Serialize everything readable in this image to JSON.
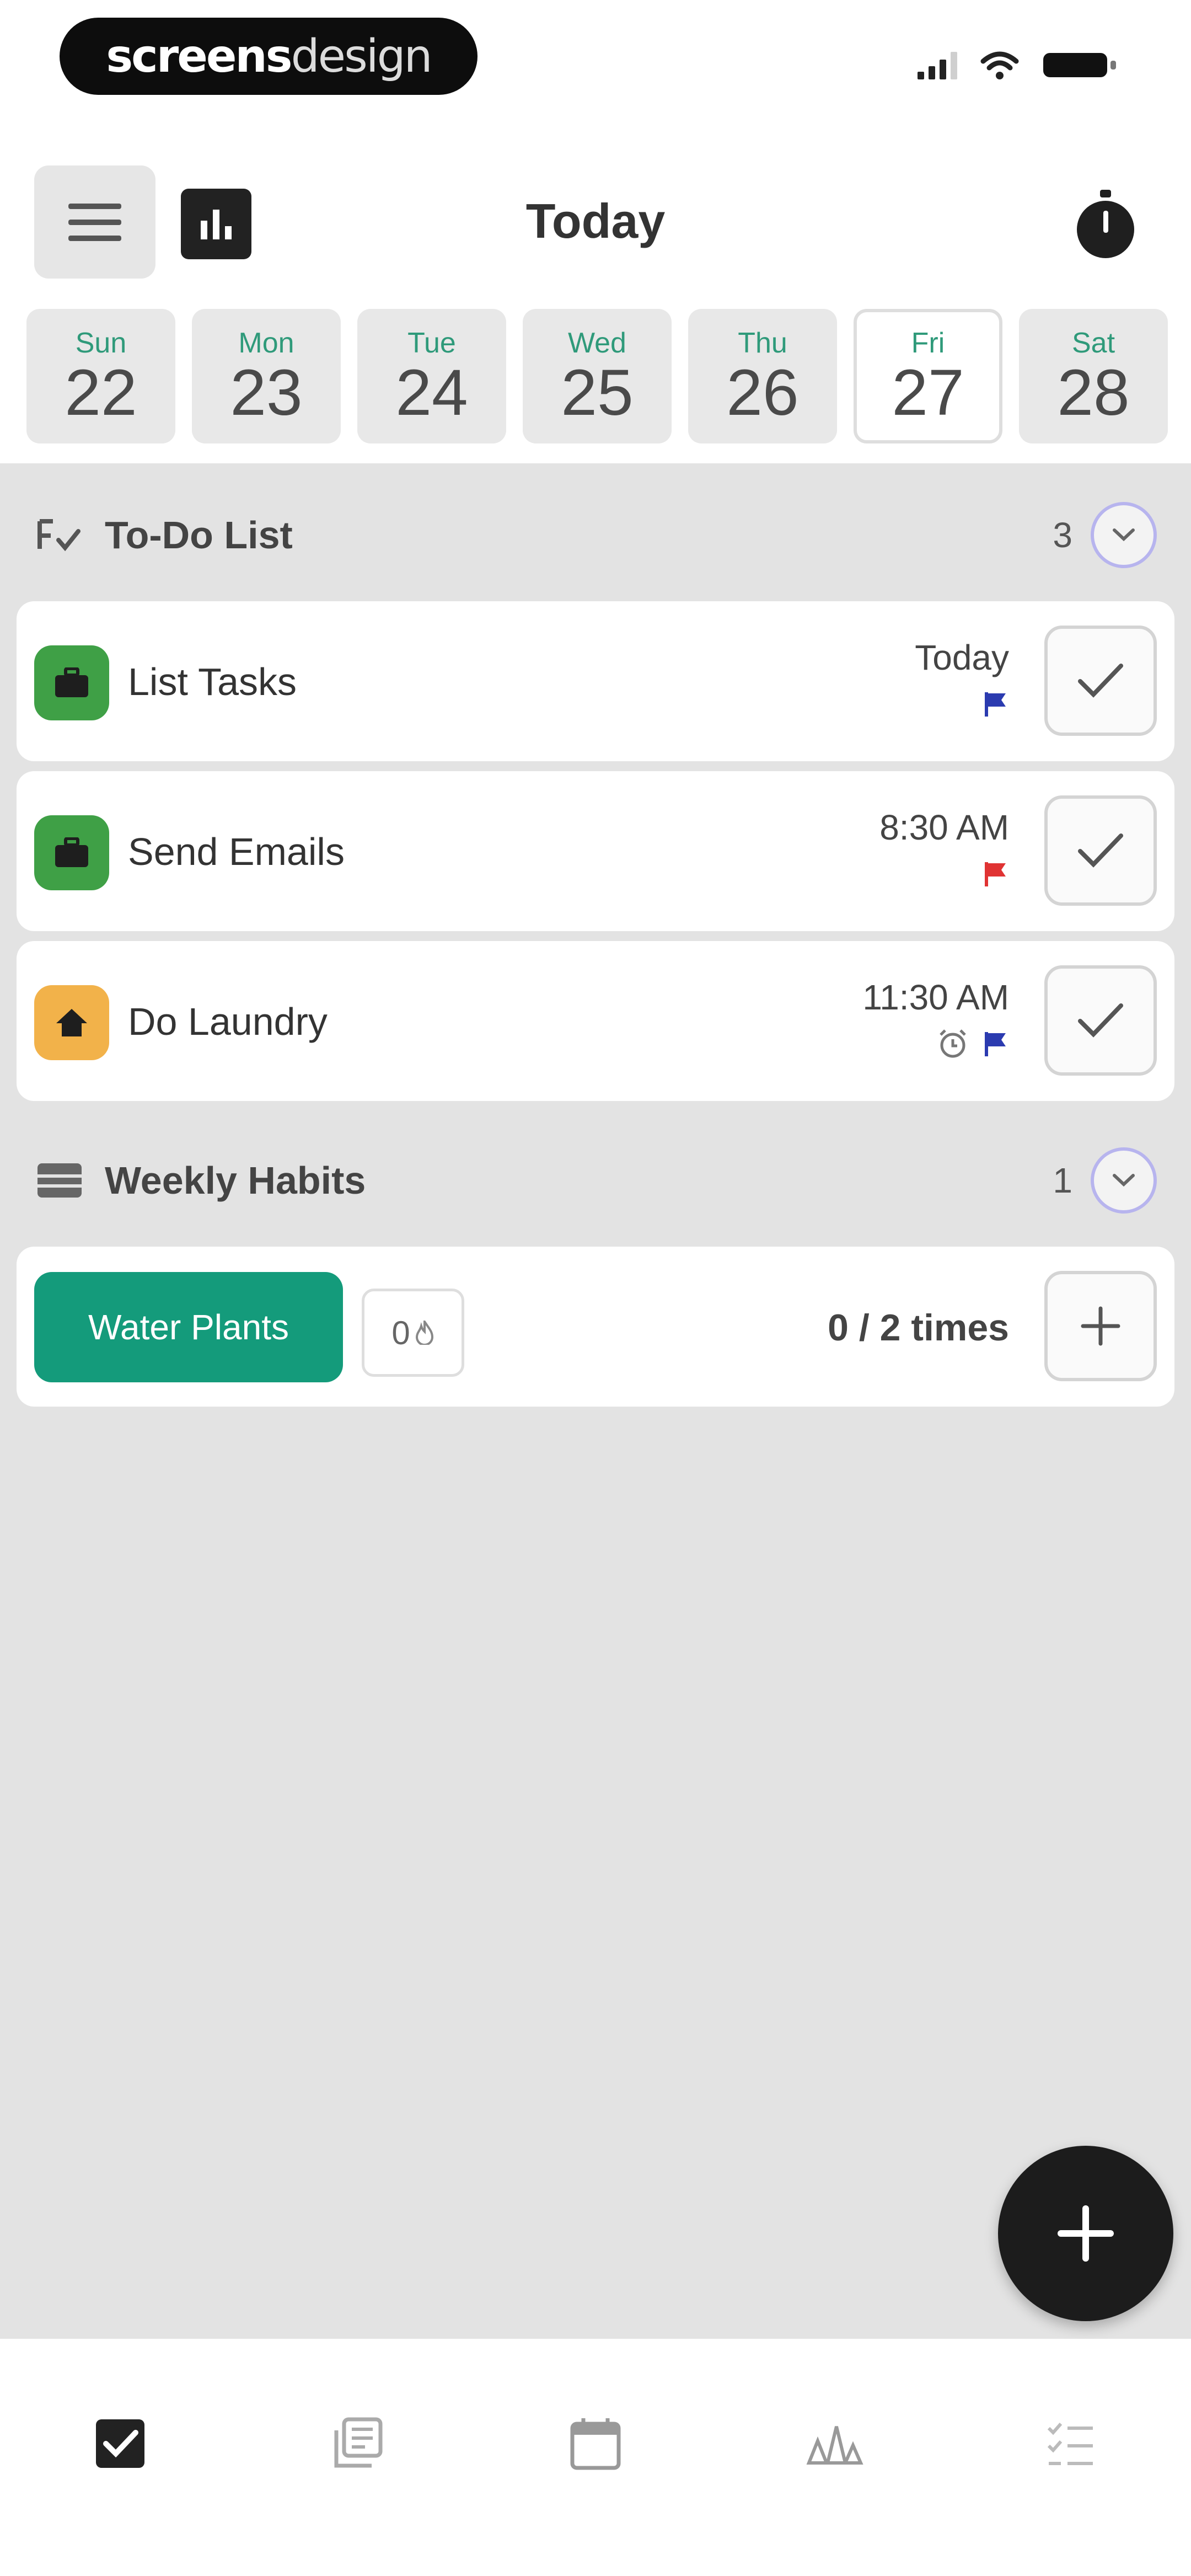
{
  "status_bar": {
    "brand_bold": "screens",
    "brand_light": "design"
  },
  "header": {
    "title": "Today",
    "icons": [
      "menu-icon",
      "stats-icon",
      "stopwatch-icon"
    ]
  },
  "week": [
    {
      "day": "Sun",
      "date": "22",
      "selected": false
    },
    {
      "day": "Mon",
      "date": "23",
      "selected": false
    },
    {
      "day": "Tue",
      "date": "24",
      "selected": false
    },
    {
      "day": "Wed",
      "date": "25",
      "selected": false
    },
    {
      "day": "Thu",
      "date": "26",
      "selected": false
    },
    {
      "day": "Fri",
      "date": "27",
      "selected": true
    },
    {
      "day": "Sat",
      "date": "28",
      "selected": false
    }
  ],
  "todo": {
    "title": "To-Do List",
    "count": "3",
    "tasks": [
      {
        "name": "List Tasks",
        "time": "Today",
        "category_icon": "briefcase-icon",
        "category_color": "#3fa046",
        "flag_color": "#2b3bb0",
        "alarm": false
      },
      {
        "name": "Send Emails",
        "time": "8:30 AM",
        "category_icon": "briefcase-icon",
        "category_color": "#3fa046",
        "flag_color": "#e03333",
        "alarm": false
      },
      {
        "name": "Do Laundry",
        "time": "11:30 AM",
        "category_icon": "home-icon",
        "category_color": "#f2b24a",
        "flag_color": "#2b3bb0",
        "alarm": true
      }
    ]
  },
  "habits": {
    "title": "Weekly Habits",
    "count": "1",
    "items": [
      {
        "name": "Water Plants",
        "streak": "0",
        "progress": "0 / 2 times"
      }
    ]
  },
  "bottom_nav": [
    {
      "icon": "checkbox-icon",
      "active": true
    },
    {
      "icon": "notes-icon",
      "active": false
    },
    {
      "icon": "calendar-icon",
      "active": false
    },
    {
      "icon": "habits-icon",
      "active": false
    },
    {
      "icon": "checklist-icon",
      "active": false
    }
  ],
  "colors": {
    "accent_green": "#149b7b",
    "day_name": "#2f9a7a",
    "collapse_ring": "#b7b4ee"
  }
}
